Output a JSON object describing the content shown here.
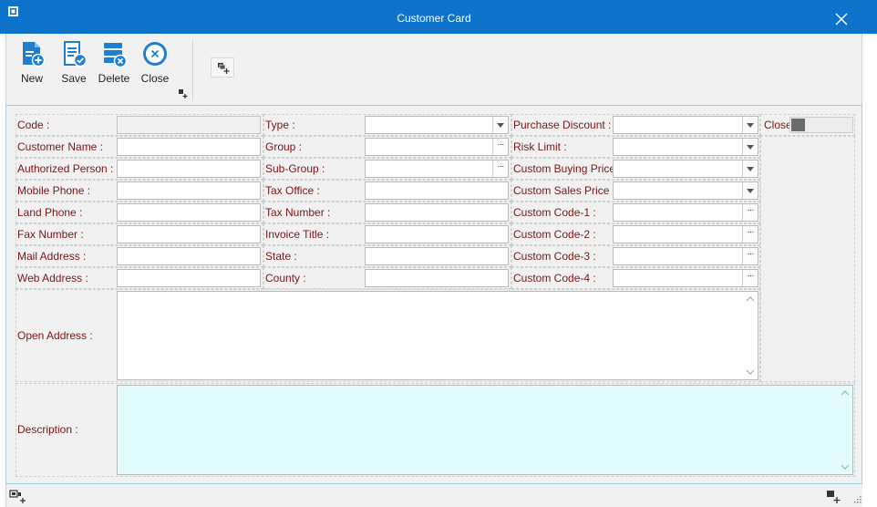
{
  "window": {
    "title": "Customer Card"
  },
  "toolbar": {
    "new_label": "New",
    "save_label": "Save",
    "delete_label": "Delete",
    "close_label": "Close"
  },
  "form": {
    "code": {
      "label": "Code :",
      "value": ""
    },
    "customer_name": {
      "label": "Customer Name :",
      "value": ""
    },
    "authorized_person": {
      "label": "Authorized Person :",
      "value": ""
    },
    "mobile_phone": {
      "label": "Mobile Phone :",
      "value": ""
    },
    "land_phone": {
      "label": "Land Phone :",
      "value": ""
    },
    "fax_number": {
      "label": "Fax Number :",
      "value": ""
    },
    "mail_address": {
      "label": "Mail Address :",
      "value": ""
    },
    "web_address": {
      "label": "Web Address :",
      "value": ""
    },
    "type": {
      "label": "Type :",
      "value": ""
    },
    "group": {
      "label": "Group :",
      "value": ""
    },
    "sub_group": {
      "label": "Sub-Group :",
      "value": ""
    },
    "tax_office": {
      "label": "Tax Office :",
      "value": ""
    },
    "tax_number": {
      "label": "Tax Number :",
      "value": ""
    },
    "invoice_title": {
      "label": "Invoice Title :",
      "value": ""
    },
    "state": {
      "label": "State :",
      "value": ""
    },
    "county": {
      "label": "County :",
      "value": ""
    },
    "purchase_discount": {
      "label": "Purchase Discount :",
      "value": ""
    },
    "risk_limit": {
      "label": "Risk Limit :",
      "value": ""
    },
    "custom_buying_price": {
      "label": "Custom Buying Price :",
      "value": ""
    },
    "custom_sales_price": {
      "label": "Custom Sales Price :",
      "value": ""
    },
    "custom_code_1": {
      "label": "Custom Code-1 :",
      "value": ""
    },
    "custom_code_2": {
      "label": "Custom Code-2 :",
      "value": ""
    },
    "custom_code_3": {
      "label": "Custom Code-3 :",
      "value": ""
    },
    "custom_code_4": {
      "label": "Custom Code-4 :",
      "value": ""
    },
    "open_address": {
      "label": "Open Address :",
      "value": ""
    },
    "description": {
      "label": "Description :",
      "value": ""
    },
    "close_toggle": {
      "label": "Close",
      "checked": false
    }
  },
  "colors": {
    "title_bar": "#0d72c9",
    "label_text": "#7a1515",
    "description_background": "#e2fcfe",
    "icon_blue": "#1e7fd1"
  },
  "icons": [
    "new-document-icon",
    "save-icon",
    "delete-icon",
    "close-circle-icon",
    "layout-icon",
    "window-close-icon",
    "dropdown-arrow-icon",
    "ellipsis-icon"
  ]
}
